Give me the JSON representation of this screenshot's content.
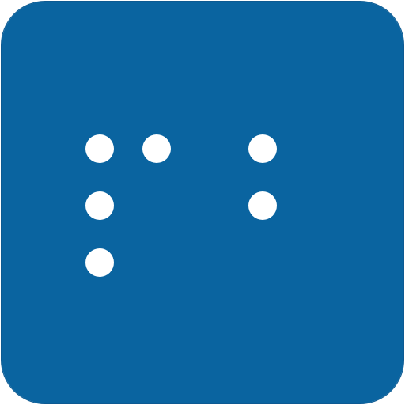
{
  "icon": {
    "name": "braille-app-icon",
    "background_color": "#0a64a0",
    "dot_color": "#ffffff",
    "cells": [
      {
        "name": "braille-cell-1",
        "dots_raised": [
          1,
          2,
          3,
          4
        ]
      },
      {
        "name": "braille-cell-2",
        "dots_raised": [
          4,
          5
        ]
      }
    ]
  }
}
